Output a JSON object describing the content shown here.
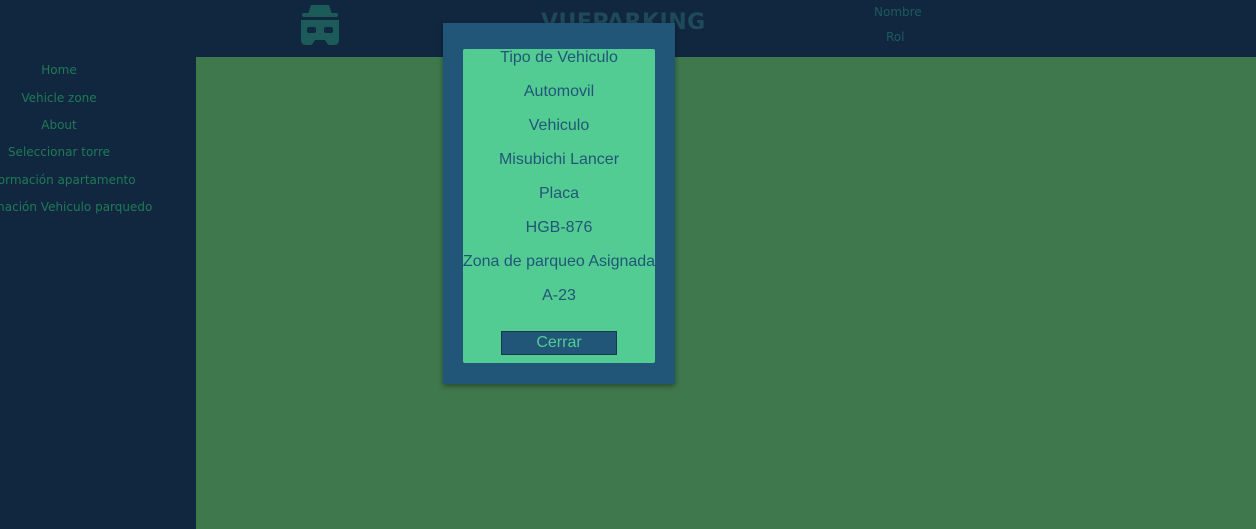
{
  "header": {
    "brand": "VUEPARKING",
    "user_name": "Nombre",
    "user_role": "Rol",
    "logo_icon": "incognito-car-icon"
  },
  "sidebar": {
    "items": [
      {
        "label": "Home"
      },
      {
        "label": "Vehicle zone"
      },
      {
        "label": "About"
      },
      {
        "label": "Seleccionar torre"
      },
      {
        "label": "Información apartamento"
      },
      {
        "label": "Información Vehiculo parquedo"
      }
    ]
  },
  "modal": {
    "lines": [
      "Tipo de Vehiculo",
      "Automovil",
      "Vehiculo",
      "Misubichi Lancer",
      "Placa",
      "HGB-876",
      "Zona de parqueo Asignada",
      "A-23"
    ],
    "close_label": "Cerrar"
  },
  "colors": {
    "background": "#112740",
    "main": "#3f784c",
    "modal": "#225678",
    "card": "#52cc93"
  }
}
